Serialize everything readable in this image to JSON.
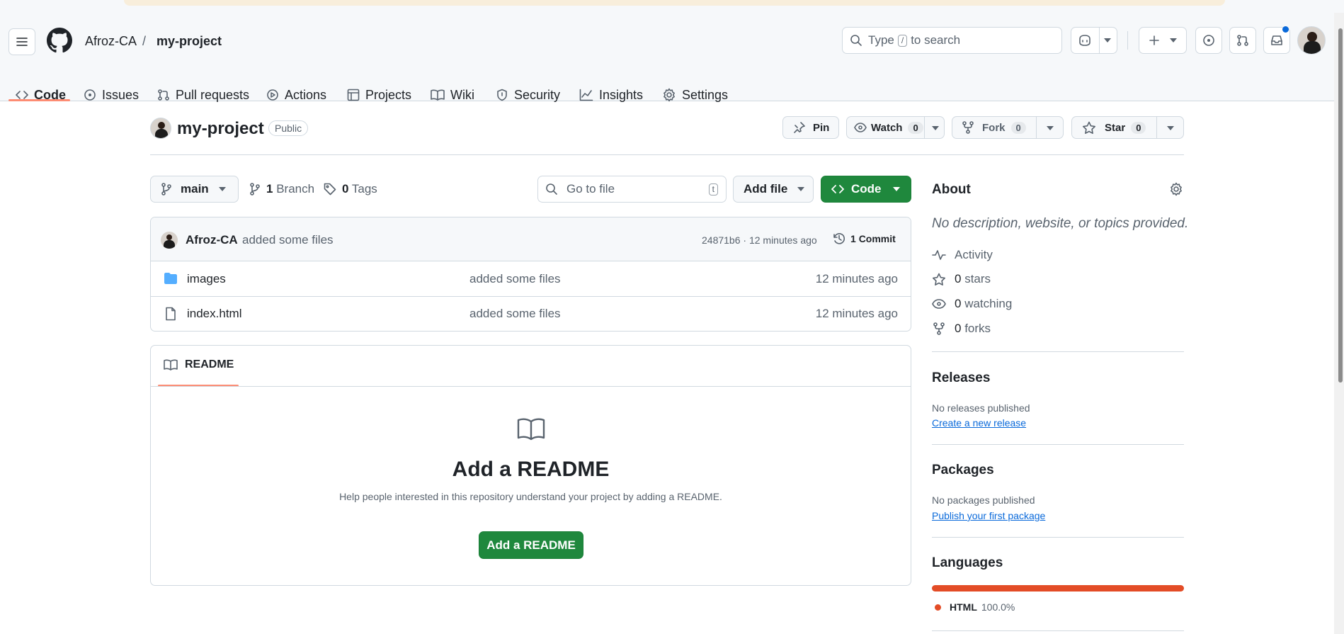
{
  "header": {
    "owner": "Afroz-CA",
    "separator": "/",
    "repo": "my-project",
    "search_prefix": "Type",
    "search_key": "/",
    "search_suffix": "to search"
  },
  "nav": {
    "items": [
      {
        "label": "Code"
      },
      {
        "label": "Issues"
      },
      {
        "label": "Pull requests"
      },
      {
        "label": "Actions"
      },
      {
        "label": "Projects"
      },
      {
        "label": "Wiki"
      },
      {
        "label": "Security"
      },
      {
        "label": "Insights"
      },
      {
        "label": "Settings"
      }
    ]
  },
  "repo": {
    "name": "my-project",
    "visibility": "Public",
    "pin_label": "Pin",
    "watch_label": "Watch",
    "watch_count": "0",
    "fork_label": "Fork",
    "fork_count": "0",
    "star_label": "Star",
    "star_count": "0"
  },
  "toolbar": {
    "branch": "main",
    "branches_count": "1",
    "branches_label": "Branch",
    "tags_count": "0",
    "tags_label": "Tags",
    "goto_placeholder": "Go to file",
    "goto_key": "t",
    "add_file_label": "Add file",
    "code_label": "Code"
  },
  "commit": {
    "author": "Afroz-CA",
    "message": "added some files",
    "hash_time": "24871b6 · 12 minutes ago",
    "commits_count": "1",
    "commits_label": "Commit"
  },
  "files": [
    {
      "name": "images",
      "type": "folder",
      "message": "added some files",
      "time": "12 minutes ago"
    },
    {
      "name": "index.html",
      "type": "file",
      "message": "added some files",
      "time": "12 minutes ago"
    }
  ],
  "readme": {
    "tab_label": "README",
    "title": "Add a README",
    "description": "Help people interested in this repository understand your project by adding a README.",
    "button_label": "Add a README"
  },
  "about": {
    "heading": "About",
    "description": "No description, website, or topics provided.",
    "activity_label": "Activity",
    "stars_count": "0",
    "stars_label": "stars",
    "watching_count": "0",
    "watching_label": "watching",
    "forks_count": "0",
    "forks_label": "forks"
  },
  "releases": {
    "heading": "Releases",
    "status": "No releases published",
    "link": "Create a new release"
  },
  "packages": {
    "heading": "Packages",
    "status": "No packages published",
    "link": "Publish your first package"
  },
  "languages": {
    "heading": "Languages",
    "items": [
      {
        "name": "HTML",
        "percent": "100.0%",
        "share": 1.0,
        "color": "#e34c26"
      }
    ]
  },
  "colors": {
    "accent_underline": "#fd8c73",
    "primary_green": "#1f883d",
    "link_blue": "#0969da",
    "folder_blue": "#54aeff",
    "html_orange": "#e34c26"
  }
}
